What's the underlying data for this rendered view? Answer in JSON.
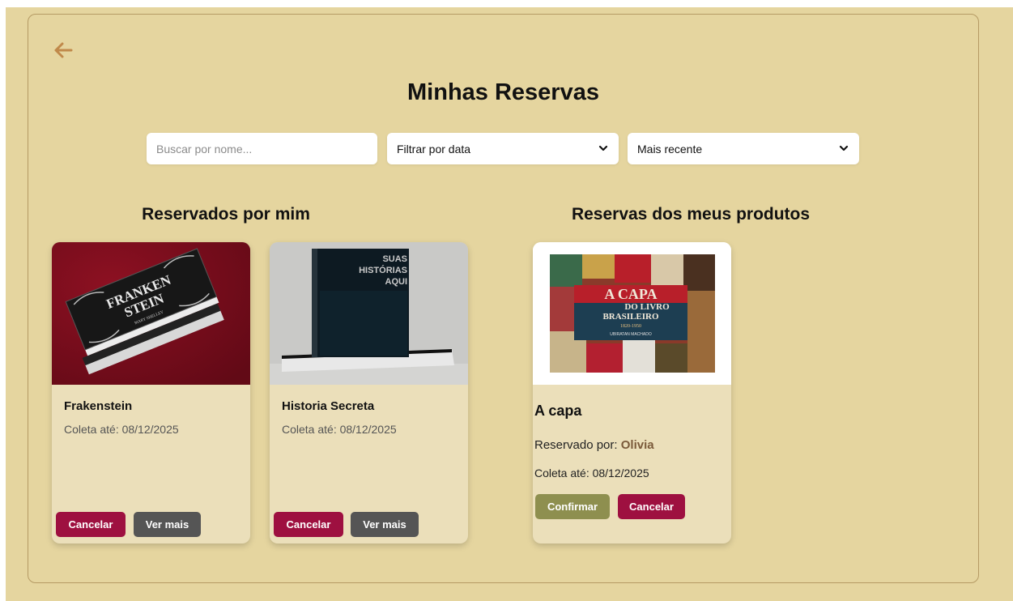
{
  "header": {
    "title": "Minhas Reservas"
  },
  "filters": {
    "search_placeholder": "Buscar por nome...",
    "date_filter": "Filtrar por data",
    "order_filter": "Mais recente"
  },
  "sections": {
    "mine_title": "Reservados por mim",
    "products_title": "Reservas dos meus produtos"
  },
  "my_reservations": [
    {
      "title": "Frakenstein",
      "pickup": "Coleta até: 08/12/2025",
      "cover_text": [
        "FRANKEN",
        "STEIN",
        "MARY SHELLEY"
      ],
      "cancel_label": "Cancelar",
      "more_label": "Ver mais"
    },
    {
      "title": "Historia Secreta",
      "pickup": "Coleta até: 08/12/2025",
      "cover_text": [
        "SUAS",
        "HISTÓRIAS",
        "AQUI"
      ],
      "cancel_label": "Cancelar",
      "more_label": "Ver mais"
    }
  ],
  "product_reservations": [
    {
      "title": "A capa",
      "reserved_by_label": "Reservado por:",
      "reserved_by_name": "Olivia",
      "pickup": "Coleta até: 08/12/2025",
      "cover_text": [
        "A CAPA",
        "DO LIVRO",
        "BRASILEIRO",
        "1820-1950",
        "UBIRATAN MACHADO"
      ],
      "confirm_label": "Confirmar",
      "cancel_label": "Cancelar"
    }
  ],
  "colors": {
    "background": "#e5d59f",
    "card": "#ebdfba",
    "cancel": "#9e1040",
    "more": "#555555",
    "confirm": "#8e8f4f",
    "back_arrow": "#c0894a"
  },
  "icons": {
    "back": "arrow-left-icon",
    "dropdown": "chevron-down-icon"
  }
}
